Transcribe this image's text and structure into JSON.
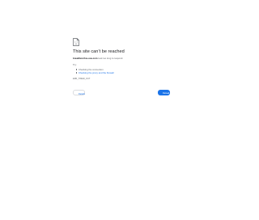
{
  "error": {
    "title": "This site can’t be reached",
    "host": "breakfast-fixe-usa.com",
    "message": "took too long to respond.",
    "try_label": "Try:",
    "suggestions": [
      {
        "text": "Checking the connection"
      },
      {
        "text": "Checking the proxy and the firewall"
      }
    ],
    "code": "ERR_TIMED_OUT",
    "icon": "sad-document-icon"
  },
  "buttons": {
    "details": "Details",
    "reload": "Reload"
  },
  "colors": {
    "accent": "#1a73e8",
    "text": "#202124",
    "muted": "#5f6368"
  }
}
